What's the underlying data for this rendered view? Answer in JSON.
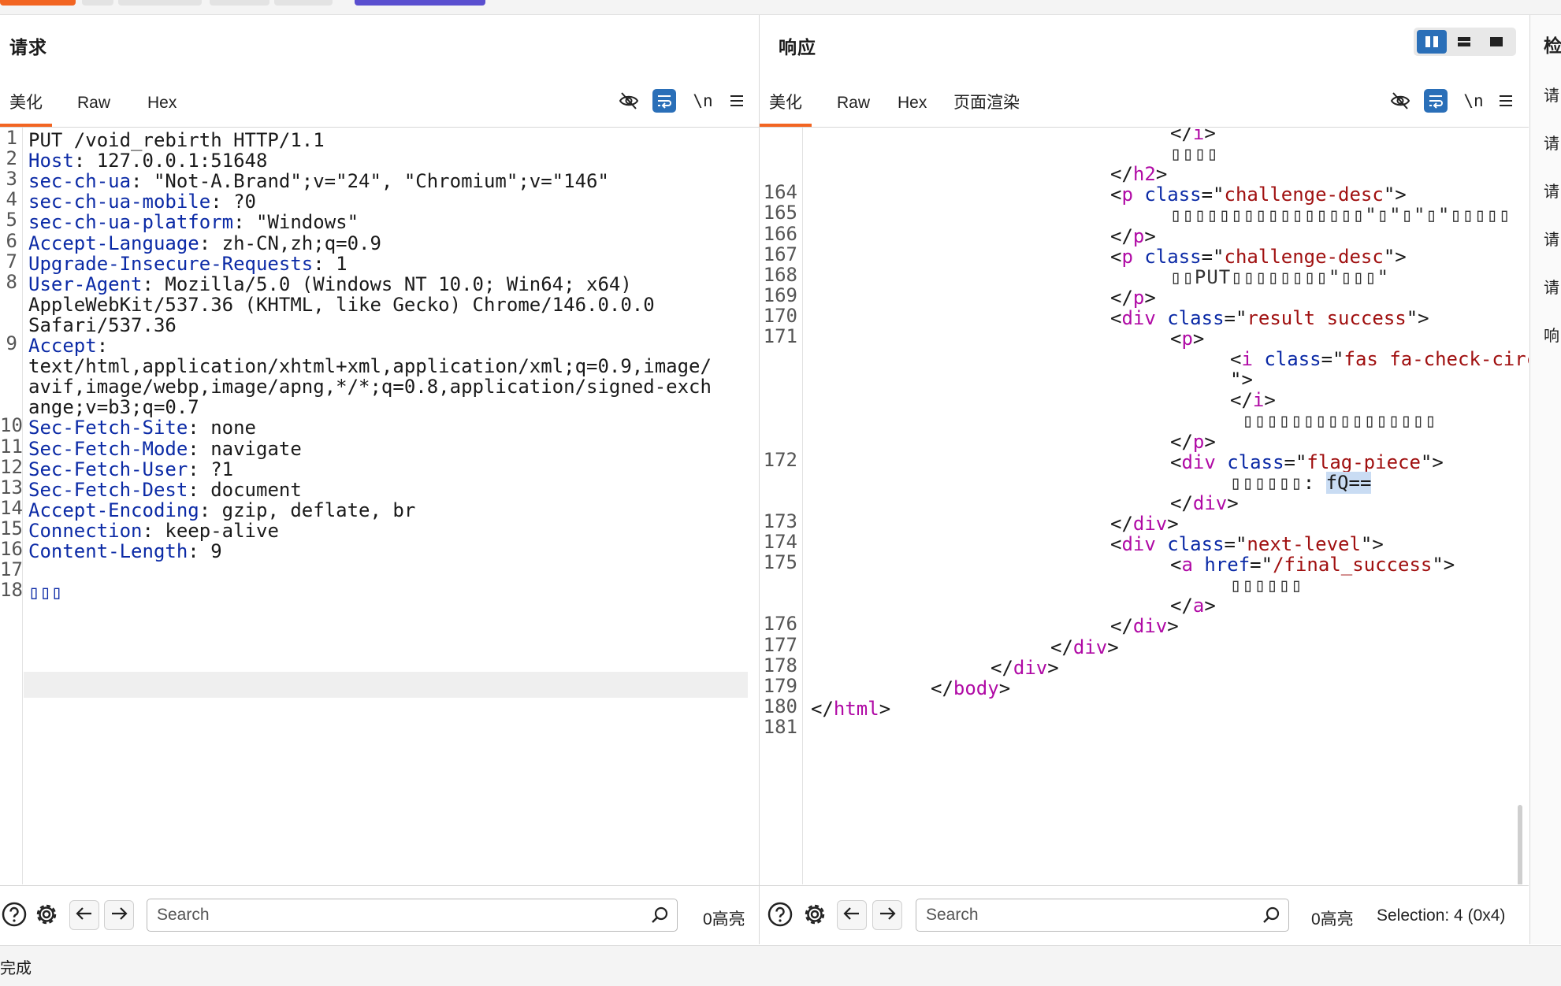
{
  "request": {
    "title": "请求",
    "tabs": [
      "美化",
      "Raw",
      "Hex"
    ],
    "active_tab": "美化",
    "lines": [
      {
        "n": "1",
        "segs": [
          [
            "p",
            "PUT /void_rebirth HTTP/1.1"
          ]
        ]
      },
      {
        "n": "2",
        "segs": [
          [
            "k",
            "Host"
          ],
          [
            "p",
            ": 127.0.0.1:51648"
          ]
        ]
      },
      {
        "n": "3",
        "segs": [
          [
            "k",
            "sec-ch-ua"
          ],
          [
            "p",
            ": \"Not-A.Brand\";v=\"24\", \"Chromium\";v=\"146\""
          ]
        ]
      },
      {
        "n": "4",
        "segs": [
          [
            "k",
            "sec-ch-ua-mobile"
          ],
          [
            "p",
            ": ?0"
          ]
        ]
      },
      {
        "n": "5",
        "segs": [
          [
            "k",
            "sec-ch-ua-platform"
          ],
          [
            "p",
            ": \"Windows\""
          ]
        ]
      },
      {
        "n": "6",
        "segs": [
          [
            "k",
            "Accept-Language"
          ],
          [
            "p",
            ": zh-CN,zh;q=0.9"
          ]
        ]
      },
      {
        "n": "7",
        "segs": [
          [
            "k",
            "Upgrade-Insecure-Requests"
          ],
          [
            "p",
            ": 1"
          ]
        ]
      },
      {
        "n": "8",
        "segs": [
          [
            "k",
            "User-Agent"
          ],
          [
            "p",
            ": Mozilla/5.0 (Windows NT 10.0; Win64; x64)"
          ]
        ]
      },
      {
        "n": "",
        "segs": [
          [
            "p",
            "AppleWebKit/537.36 (KHTML, like Gecko) Chrome/146.0.0.0"
          ]
        ]
      },
      {
        "n": "",
        "segs": [
          [
            "p",
            "Safari/537.36"
          ]
        ]
      },
      {
        "n": "9",
        "segs": [
          [
            "k",
            "Accept"
          ],
          [
            "p",
            ":"
          ]
        ]
      },
      {
        "n": "",
        "segs": [
          [
            "p",
            "text/html,application/xhtml+xml,application/xml;q=0.9,image/"
          ]
        ]
      },
      {
        "n": "",
        "segs": [
          [
            "p",
            "avif,image/webp,image/apng,*/*;q=0.8,application/signed-exch"
          ]
        ]
      },
      {
        "n": "",
        "segs": [
          [
            "p",
            "ange;v=b3;q=0.7"
          ]
        ]
      },
      {
        "n": "10",
        "segs": [
          [
            "k",
            "Sec-Fetch-Site"
          ],
          [
            "p",
            ": none"
          ]
        ]
      },
      {
        "n": "11",
        "segs": [
          [
            "k",
            "Sec-Fetch-Mode"
          ],
          [
            "p",
            ": navigate"
          ]
        ]
      },
      {
        "n": "12",
        "segs": [
          [
            "k",
            "Sec-Fetch-User"
          ],
          [
            "p",
            ": ?1"
          ]
        ]
      },
      {
        "n": "13",
        "segs": [
          [
            "k",
            "Sec-Fetch-Dest"
          ],
          [
            "p",
            ": document"
          ]
        ]
      },
      {
        "n": "14",
        "segs": [
          [
            "k",
            "Accept-Encoding"
          ],
          [
            "p",
            ": gzip, deflate, br"
          ]
        ]
      },
      {
        "n": "15",
        "segs": [
          [
            "k",
            "Connection"
          ],
          [
            "p",
            ": keep-alive"
          ]
        ]
      },
      {
        "n": "16",
        "segs": [
          [
            "k",
            "Content-Length"
          ],
          [
            "p",
            ": 9"
          ]
        ]
      },
      {
        "n": "17",
        "segs": []
      },
      {
        "n": "18",
        "segs": [
          [
            "k",
            "▯▯▯"
          ]
        ]
      }
    ],
    "search_placeholder": "Search",
    "highlight_count": "0高亮"
  },
  "response": {
    "title": "响应",
    "tabs": [
      "美化",
      "Raw",
      "Hex",
      "页面渲染"
    ],
    "active_tab": "美化",
    "lines": [
      {
        "n": "",
        "ind": 6,
        "segs": [
          [
            "p",
            "</"
          ],
          [
            "t",
            "i"
          ],
          [
            "p",
            ">"
          ]
        ]
      },
      {
        "n": "",
        "ind": 6,
        "segs": [
          [
            "box",
            "▯▯▯▯"
          ]
        ]
      },
      {
        "n": "",
        "ind": 5,
        "segs": [
          [
            "p",
            "</"
          ],
          [
            "t",
            "h2"
          ],
          [
            "p",
            ">"
          ]
        ]
      },
      {
        "n": "164",
        "ind": 5,
        "segs": [
          [
            "p",
            "<"
          ],
          [
            "t",
            "p"
          ],
          [
            "p",
            " "
          ],
          [
            "a",
            "class"
          ],
          [
            "p",
            "=\""
          ],
          [
            "s",
            "challenge-desc"
          ],
          [
            "p",
            "\">"
          ]
        ]
      },
      {
        "n": "165",
        "ind": 6,
        "segs": [
          [
            "box",
            "▯▯▯▯▯▯▯▯▯▯▯▯▯▯▯▯\"▯\"▯\"▯\"▯▯▯▯▯"
          ]
        ]
      },
      {
        "n": "166",
        "ind": 5,
        "segs": [
          [
            "p",
            "</"
          ],
          [
            "t",
            "p"
          ],
          [
            "p",
            ">"
          ]
        ]
      },
      {
        "n": "167",
        "ind": 5,
        "segs": [
          [
            "p",
            "<"
          ],
          [
            "t",
            "p"
          ],
          [
            "p",
            " "
          ],
          [
            "a",
            "class"
          ],
          [
            "p",
            "=\""
          ],
          [
            "s",
            "challenge-desc"
          ],
          [
            "p",
            "\">"
          ]
        ]
      },
      {
        "n": "168",
        "ind": 6,
        "segs": [
          [
            "box",
            "▯▯PUT▯▯▯▯▯▯▯▯\"▯▯▯\""
          ]
        ]
      },
      {
        "n": "169",
        "ind": 5,
        "segs": [
          [
            "p",
            "</"
          ],
          [
            "t",
            "p"
          ],
          [
            "p",
            ">"
          ]
        ]
      },
      {
        "n": "170",
        "ind": 5,
        "segs": [
          [
            "p",
            "<"
          ],
          [
            "t",
            "div"
          ],
          [
            "p",
            " "
          ],
          [
            "a",
            "class"
          ],
          [
            "p",
            "=\""
          ],
          [
            "s",
            "result success"
          ],
          [
            "p",
            "\">"
          ]
        ]
      },
      {
        "n": "171",
        "ind": 6,
        "segs": [
          [
            "p",
            "<"
          ],
          [
            "t",
            "p"
          ],
          [
            "p",
            ">"
          ]
        ]
      },
      {
        "n": "",
        "ind": 7,
        "segs": [
          [
            "p",
            "<"
          ],
          [
            "t",
            "i"
          ],
          [
            "p",
            " "
          ],
          [
            "a",
            "class"
          ],
          [
            "p",
            "=\""
          ],
          [
            "s",
            "fas fa-check-circle"
          ]
        ]
      },
      {
        "n": "",
        "ind": 7,
        "segs": [
          [
            "p",
            "\">"
          ]
        ]
      },
      {
        "n": "",
        "ind": 7,
        "segs": [
          [
            "p",
            "</"
          ],
          [
            "t",
            "i"
          ],
          [
            "p",
            ">"
          ]
        ]
      },
      {
        "n": "",
        "ind": 7,
        "segs": [
          [
            "box",
            " ▯▯▯▯▯▯▯▯▯▯▯▯▯▯▯▯"
          ]
        ]
      },
      {
        "n": "",
        "ind": 6,
        "segs": [
          [
            "p",
            "</"
          ],
          [
            "t",
            "p"
          ],
          [
            "p",
            ">"
          ]
        ]
      },
      {
        "n": "172",
        "ind": 6,
        "segs": [
          [
            "p",
            "<"
          ],
          [
            "t",
            "div"
          ],
          [
            "p",
            " "
          ],
          [
            "a",
            "class"
          ],
          [
            "p",
            "=\""
          ],
          [
            "s",
            "flag-piece"
          ],
          [
            "p",
            "\">"
          ]
        ]
      },
      {
        "n": "",
        "ind": 7,
        "segs": [
          [
            "box",
            "▯▯▯▯▯▯"
          ],
          [
            "p",
            ": "
          ],
          [
            "sel",
            "fQ=="
          ]
        ]
      },
      {
        "n": "",
        "ind": 6,
        "segs": [
          [
            "p",
            "</"
          ],
          [
            "t",
            "div"
          ],
          [
            "p",
            ">"
          ]
        ]
      },
      {
        "n": "173",
        "ind": 5,
        "segs": [
          [
            "p",
            "</"
          ],
          [
            "t",
            "div"
          ],
          [
            "p",
            ">"
          ]
        ]
      },
      {
        "n": "174",
        "ind": 5,
        "segs": [
          [
            "p",
            "<"
          ],
          [
            "t",
            "div"
          ],
          [
            "p",
            " "
          ],
          [
            "a",
            "class"
          ],
          [
            "p",
            "=\""
          ],
          [
            "s",
            "next-level"
          ],
          [
            "p",
            "\">"
          ]
        ]
      },
      {
        "n": "175",
        "ind": 6,
        "segs": [
          [
            "p",
            "<"
          ],
          [
            "t",
            "a"
          ],
          [
            "p",
            " "
          ],
          [
            "a",
            "href"
          ],
          [
            "p",
            "=\""
          ],
          [
            "s",
            "/final_success"
          ],
          [
            "p",
            "\">"
          ]
        ]
      },
      {
        "n": "",
        "ind": 7,
        "segs": [
          [
            "box",
            "▯▯▯▯▯▯"
          ]
        ]
      },
      {
        "n": "",
        "ind": 6,
        "segs": [
          [
            "p",
            "</"
          ],
          [
            "t",
            "a"
          ],
          [
            "p",
            ">"
          ]
        ]
      },
      {
        "n": "176",
        "ind": 5,
        "segs": [
          [
            "p",
            "</"
          ],
          [
            "t",
            "div"
          ],
          [
            "p",
            ">"
          ]
        ]
      },
      {
        "n": "177",
        "ind": 4,
        "segs": [
          [
            "p",
            "</"
          ],
          [
            "t",
            "div"
          ],
          [
            "p",
            ">"
          ]
        ]
      },
      {
        "n": "178",
        "ind": 3,
        "segs": [
          [
            "p",
            "</"
          ],
          [
            "t",
            "div"
          ],
          [
            "p",
            ">"
          ]
        ]
      },
      {
        "n": "179",
        "ind": 2,
        "segs": [
          [
            "p",
            "</"
          ],
          [
            "t",
            "body"
          ],
          [
            "p",
            ">"
          ]
        ]
      },
      {
        "n": "180",
        "ind": 0,
        "segs": [
          [
            "p",
            "</"
          ],
          [
            "t",
            "html"
          ],
          [
            "p",
            ">"
          ]
        ]
      },
      {
        "n": "181",
        "ind": 0,
        "segs": []
      }
    ],
    "search_placeholder": "Search",
    "highlight_count": "0高亮",
    "selection": "Selection: 4 (0x4)"
  },
  "inspector": {
    "title": "检",
    "items": [
      "请",
      "请",
      "请",
      "请",
      "请",
      "响"
    ]
  },
  "status": "完成",
  "colors": {
    "accent": "#f26522",
    "primary": "#2a6fb8",
    "purple_stub": "#5a4fcf"
  },
  "icons": {
    "hide": "eye-slash-icon",
    "wrap": "wrap-icon",
    "newline": "newline-icon",
    "menu": "hamburger-icon",
    "help": "help-icon",
    "settings": "gear-icon",
    "prev": "arrow-left-icon",
    "next": "arrow-right-icon",
    "search": "magnifier-icon"
  }
}
